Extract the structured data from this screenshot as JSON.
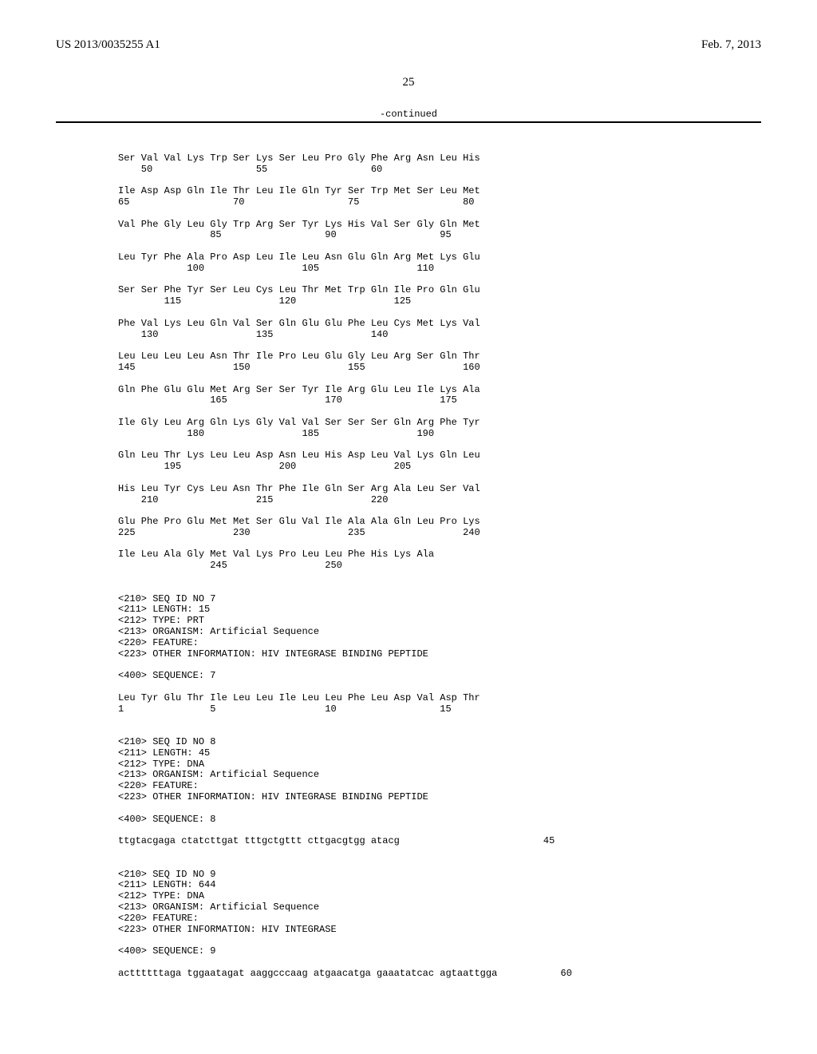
{
  "header": {
    "app_number": "US 2013/0035255 A1",
    "pub_date": "Feb. 7, 2013"
  },
  "page_number": "25",
  "continued": "-continued",
  "seq_body": "\nSer Val Val Lys Trp Ser Lys Ser Leu Pro Gly Phe Arg Asn Leu His\n    50                  55                  60\n\nIle Asp Asp Gln Ile Thr Leu Ile Gln Tyr Ser Trp Met Ser Leu Met\n65                  70                  75                  80\n\nVal Phe Gly Leu Gly Trp Arg Ser Tyr Lys His Val Ser Gly Gln Met\n                85                  90                  95\n\nLeu Tyr Phe Ala Pro Asp Leu Ile Leu Asn Glu Gln Arg Met Lys Glu\n            100                 105                 110\n\nSer Ser Phe Tyr Ser Leu Cys Leu Thr Met Trp Gln Ile Pro Gln Glu\n        115                 120                 125\n\nPhe Val Lys Leu Gln Val Ser Gln Glu Glu Phe Leu Cys Met Lys Val\n    130                 135                 140\n\nLeu Leu Leu Leu Asn Thr Ile Pro Leu Glu Gly Leu Arg Ser Gln Thr\n145                 150                 155                 160\n\nGln Phe Glu Glu Met Arg Ser Ser Tyr Ile Arg Glu Leu Ile Lys Ala\n                165                 170                 175\n\nIle Gly Leu Arg Gln Lys Gly Val Val Ser Ser Ser Gln Arg Phe Tyr\n            180                 185                 190\n\nGln Leu Thr Lys Leu Leu Asp Asn Leu His Asp Leu Val Lys Gln Leu\n        195                 200                 205\n\nHis Leu Tyr Cys Leu Asn Thr Phe Ile Gln Ser Arg Ala Leu Ser Val\n    210                 215                 220\n\nGlu Phe Pro Glu Met Met Ser Glu Val Ile Ala Ala Gln Leu Pro Lys\n225                 230                 235                 240\n\nIle Leu Ala Gly Met Val Lys Pro Leu Leu Phe His Lys Ala\n                245                 250\n\n\n<210> SEQ ID NO 7\n<211> LENGTH: 15\n<212> TYPE: PRT\n<213> ORGANISM: Artificial Sequence\n<220> FEATURE:\n<223> OTHER INFORMATION: HIV INTEGRASE BINDING PEPTIDE\n\n<400> SEQUENCE: 7\n\nLeu Tyr Glu Thr Ile Leu Leu Ile Leu Leu Phe Leu Asp Val Asp Thr\n1               5                   10                  15\n\n\n<210> SEQ ID NO 8\n<211> LENGTH: 45\n<212> TYPE: DNA\n<213> ORGANISM: Artificial Sequence\n<220> FEATURE:\n<223> OTHER INFORMATION: HIV INTEGRASE BINDING PEPTIDE\n\n<400> SEQUENCE: 8\n\nttgtacgaga ctatcttgat tttgctgttt cttgacgtgg atacg                         45\n\n\n<210> SEQ ID NO 9\n<211> LENGTH: 644\n<212> TYPE: DNA\n<213> ORGANISM: Artificial Sequence\n<220> FEATURE:\n<223> OTHER INFORMATION: HIV INTEGRASE\n\n<400> SEQUENCE: 9\n\nacttttttaga tggaatagat aaggcccaag atgaacatga gaaatatcac agtaattgga           60\n"
}
